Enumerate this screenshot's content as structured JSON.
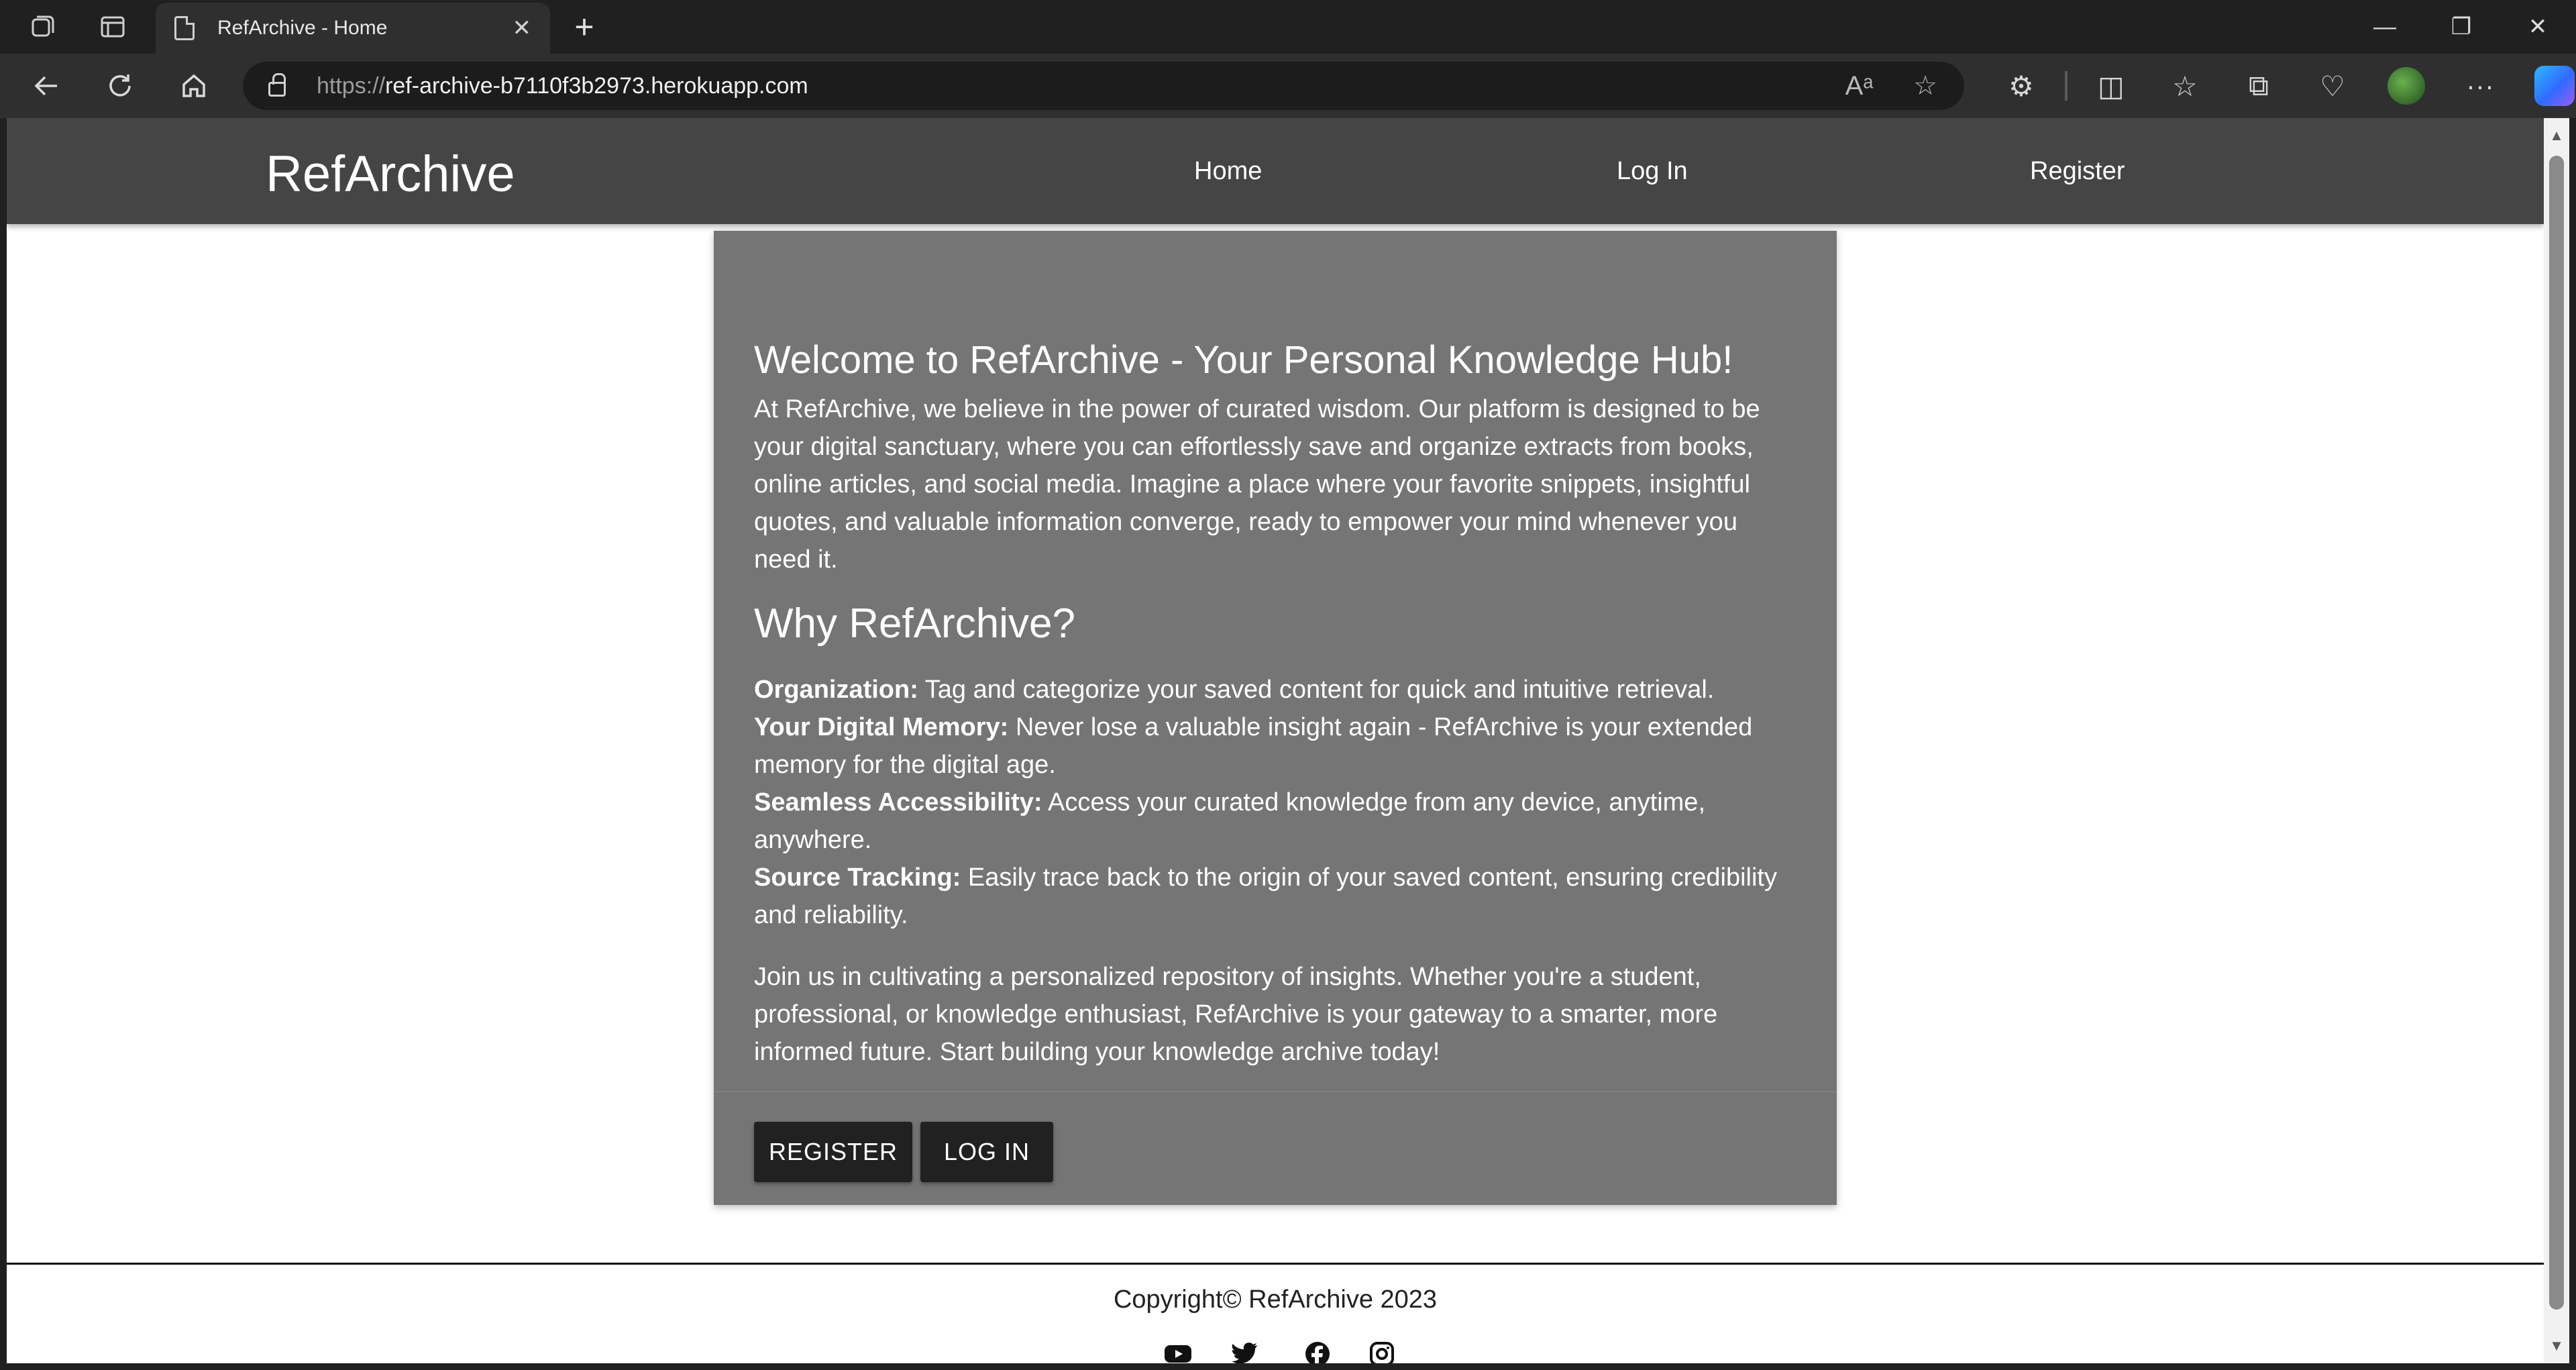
{
  "browser": {
    "tab_title": "RefArchive - Home",
    "url_prefix": "https://",
    "url_host": "ref-archive-b7110f3b2973.herokuapp.com"
  },
  "site": {
    "brand": "RefArchive",
    "nav": [
      "Home",
      "Log In",
      "Register"
    ]
  },
  "card": {
    "title": "Welcome to RefArchive - Your Personal Knowledge Hub!",
    "intro": "At RefArchive, we believe in the power of curated wisdom. Our platform is designed to be your digital sanctuary, where you can effortlessly save and organize extracts from books, online articles, and social media. Imagine a place where your favorite snippets, insightful quotes, and valuable information converge, ready to empower your mind whenever you need it.",
    "why_heading": "Why RefArchive?",
    "features": [
      {
        "label": "Organization:",
        "text": " Tag and categorize your saved content for quick and intuitive retrieval."
      },
      {
        "label": "Your Digital Memory:",
        "text": " Never lose a valuable insight again - RefArchive is your extended memory for the digital age."
      },
      {
        "label": "Seamless Accessibility:",
        "text": " Access your curated knowledge from any device, anytime, anywhere."
      },
      {
        "label": "Source Tracking:",
        "text": " Easily trace back to the origin of your saved content, ensuring credibility and reliability."
      }
    ],
    "join": "Join us in cultivating a personalized repository of insights. Whether you're a student, professional, or knowledge enthusiast, RefArchive is your gateway to a smarter, more informed future. Start building your knowledge archive today!",
    "register_button": "REGISTER",
    "login_button": "LOG IN"
  },
  "footer": {
    "copyright": "Copyright© RefArchive 2023",
    "social_icons": [
      "youtube-icon",
      "twitter-icon",
      "facebook-icon",
      "instagram-icon"
    ]
  }
}
